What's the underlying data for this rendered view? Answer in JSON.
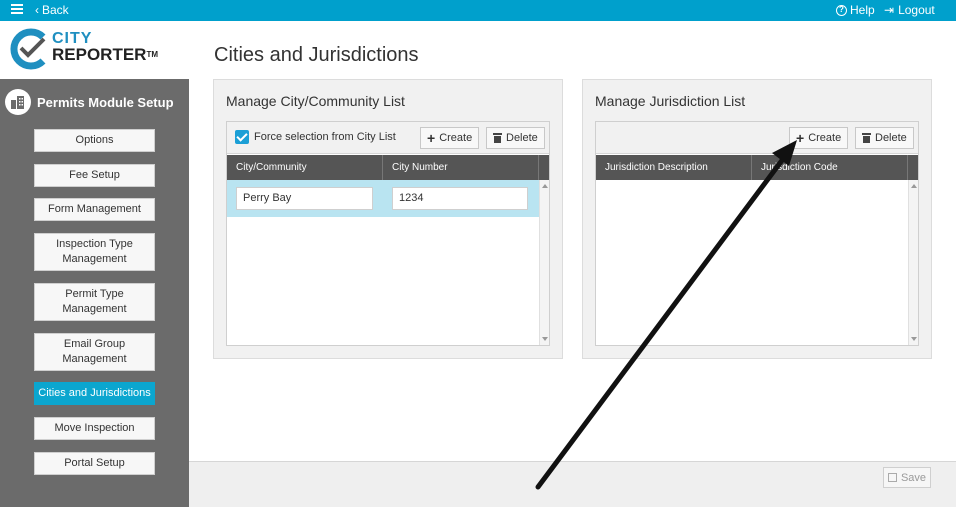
{
  "topbar": {
    "back_label": "Back",
    "help_label": "Help",
    "logout_label": "Logout"
  },
  "logo": {
    "line1": "CITY",
    "line2": "REPORTER",
    "tm": "TM"
  },
  "sidebar": {
    "module_title": "Permits Module Setup",
    "items": [
      {
        "label": "Options"
      },
      {
        "label": "Fee Setup"
      },
      {
        "label": "Form Management"
      },
      {
        "label": "Inspection Type Management"
      },
      {
        "label": "Permit Type Management"
      },
      {
        "label": "Email Group Management"
      },
      {
        "label": "Cities and Jurisdictions"
      },
      {
        "label": "Move Inspection"
      },
      {
        "label": "Portal Setup"
      }
    ],
    "active_index": 6
  },
  "main": {
    "page_title": "Cities and Jurisdictions",
    "city_panel": {
      "title": "Manage City/Community List",
      "force_selection_label": "Force selection from City List",
      "force_selection_checked": true,
      "create_label": "Create",
      "delete_label": "Delete",
      "columns": [
        "City/Community",
        "City Number"
      ],
      "rows": [
        {
          "city": "Perry Bay",
          "number": "1234"
        }
      ]
    },
    "jurisdiction_panel": {
      "title": "Manage Jurisdiction List",
      "create_label": "Create",
      "delete_label": "Delete",
      "columns": [
        "Jurisdiction Description",
        "Jurisdiction Code"
      ]
    }
  },
  "footer": {
    "save_label": "Save"
  },
  "colors": {
    "topbar": "#00a0cc",
    "sidebar": "#6b6b6b",
    "active_nav": "#0ba6cf",
    "grid_header": "#555555",
    "selected_row": "#b9e4f1"
  }
}
